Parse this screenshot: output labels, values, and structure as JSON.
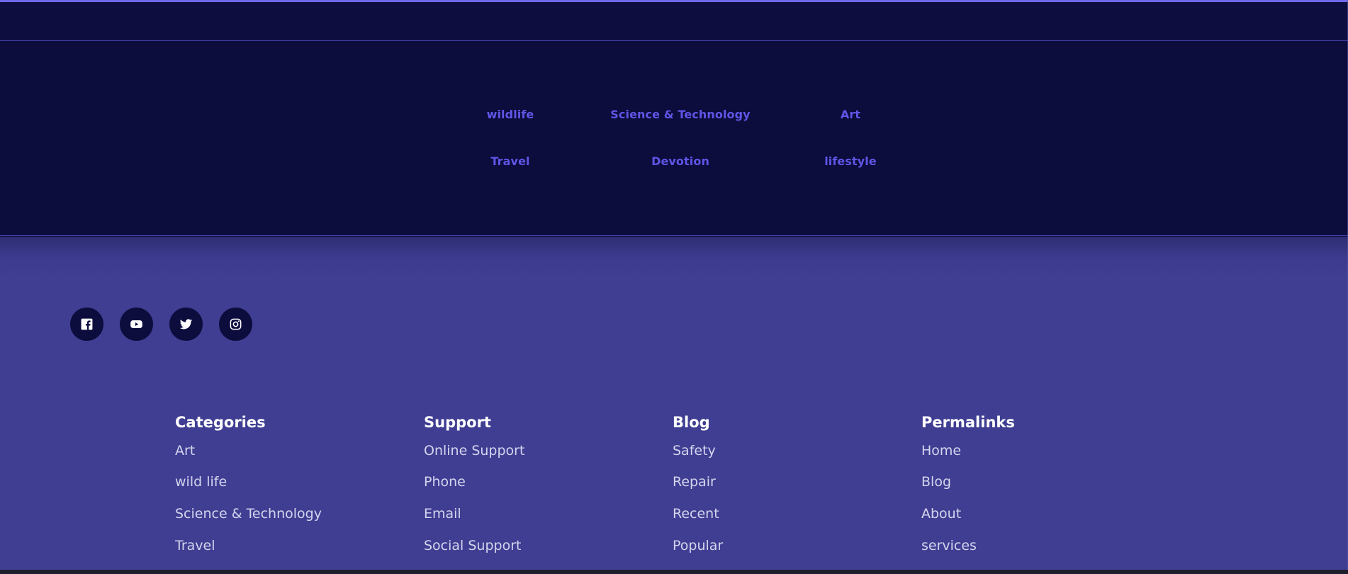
{
  "tags": [
    "wildlife",
    "Science & Technology",
    "Art",
    "Travel",
    "Devotion",
    "lifestyle"
  ],
  "social": [
    "facebook-icon",
    "youtube-icon",
    "twitter-icon",
    "instagram-icon"
  ],
  "footer": {
    "columns": [
      {
        "title": "Categories",
        "links": [
          "Art",
          "wild life",
          "Science & Technology",
          "Travel"
        ]
      },
      {
        "title": "Support",
        "links": [
          "Online Support",
          "Phone",
          "Email",
          "Social Support"
        ]
      },
      {
        "title": "Blog",
        "links": [
          "Safety",
          "Repair",
          "Recent",
          "Popular"
        ]
      },
      {
        "title": "Permalinks",
        "links": [
          "Home",
          "Blog",
          "About",
          "services"
        ]
      }
    ]
  },
  "colors": {
    "accent": "#7168f0",
    "tag_text": "#5f56e6",
    "dark_navy": "#0c0c3d",
    "footer_bg": "#3f3e92",
    "link_text": "#d5d4ee"
  }
}
